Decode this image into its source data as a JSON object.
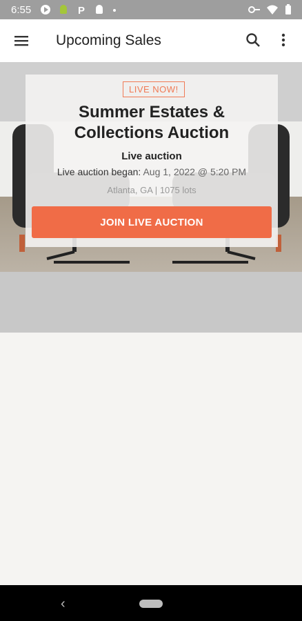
{
  "status_bar": {
    "time": "6:55"
  },
  "app_bar": {
    "title": "Upcoming Sales"
  },
  "sale": {
    "badge": "LIVE NOW!",
    "title_line1": "Summer Estates &",
    "title_line2": "Collections Auction",
    "type": "Live auction",
    "began_label": "Live auction began:",
    "began_value": "Aug 1, 2022 @ 5:20 PM",
    "location": "Atlanta, GA",
    "lots": "1075 lots",
    "separator": "|",
    "join_label": "JOIN LIVE AUCTION"
  },
  "colors": {
    "accent": "#f06c47",
    "status_bar": "#9e9e9e",
    "nav_bar": "#000000"
  }
}
